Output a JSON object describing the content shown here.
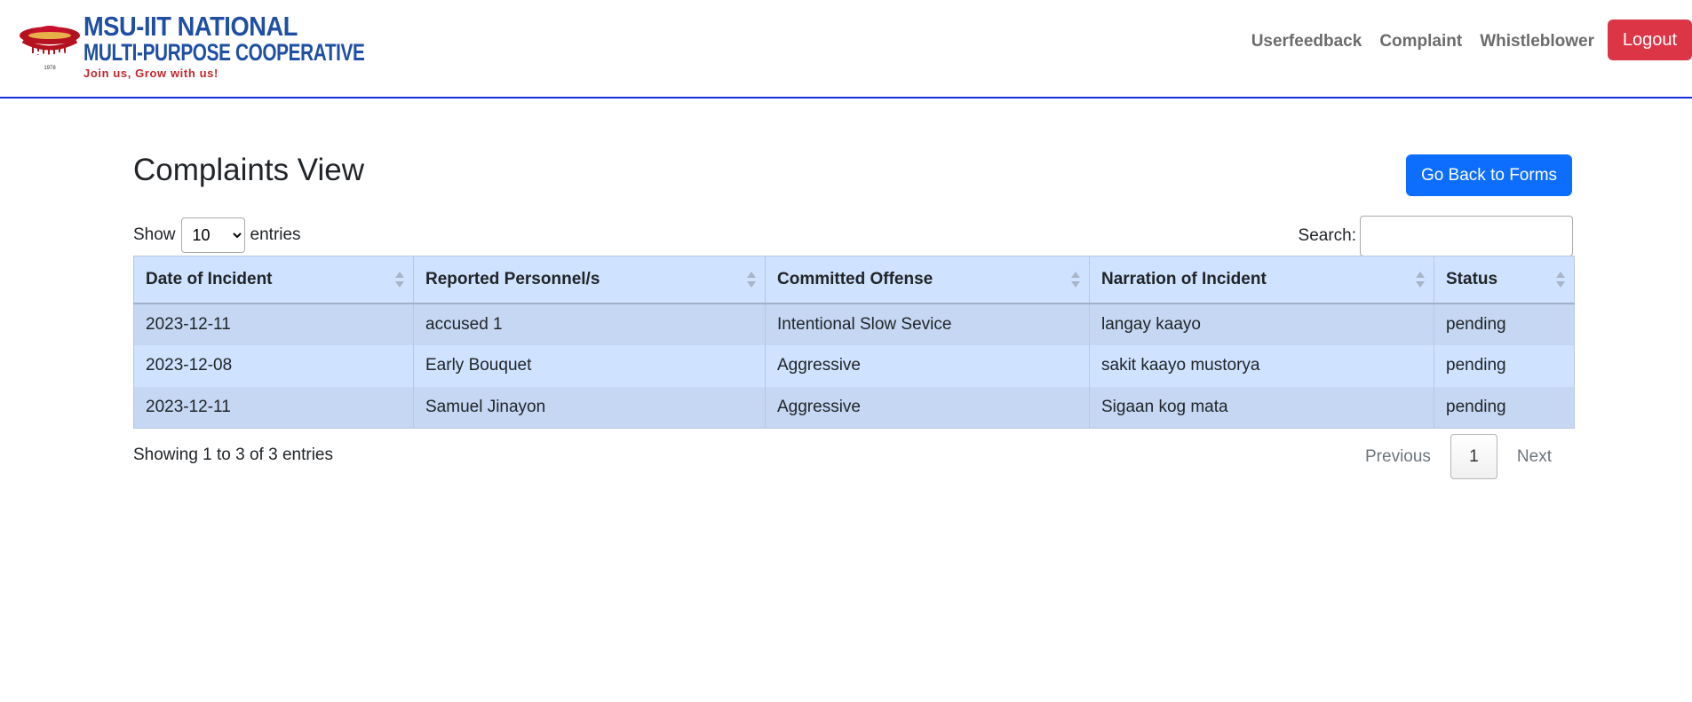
{
  "brand": {
    "line1": "MSU-IIT NATIONAL",
    "line2": "MULTI-PURPOSE COOPERATIVE",
    "tagline": "Join us, Grow with us!",
    "year": "1978",
    "icon": "cooperative-emblem-icon"
  },
  "nav": {
    "links": [
      "Userfeedback",
      "Complaint",
      "Whistleblower"
    ],
    "logout": "Logout"
  },
  "page": {
    "title": "Complaints View",
    "back_button": "Go Back to Forms"
  },
  "table_controls": {
    "show_label": "Show",
    "entries_label": "entries",
    "page_length": "10",
    "page_length_options": [
      "10"
    ],
    "search_label": "Search:",
    "search_value": ""
  },
  "table": {
    "columns": [
      "Date of Incident",
      "Reported Personnel/s",
      "Committed Offense",
      "Narration of Incident",
      "Status"
    ],
    "rows": [
      [
        "2023-12-11",
        "accused 1",
        "Intentional Slow Sevice",
        "langay kaayo",
        "pending"
      ],
      [
        "2023-12-08",
        "Early Bouquet",
        "Aggressive",
        "sakit kaayo mustorya",
        "pending"
      ],
      [
        "2023-12-11",
        "Samuel Jinayon",
        "Aggressive",
        "Sigaan kog mata",
        "pending"
      ]
    ]
  },
  "footer": {
    "info": "Showing 1 to 3 of 3 entries",
    "previous": "Previous",
    "current_page": "1",
    "next": "Next"
  },
  "colors": {
    "brand_blue": "#1f4fa3",
    "tagline_red": "#c1272d",
    "logout_red": "#dc3545",
    "primary_blue": "#0d6efd",
    "table_header_bg": "#cfe2ff",
    "nav_underline": "#1a2fd6"
  }
}
